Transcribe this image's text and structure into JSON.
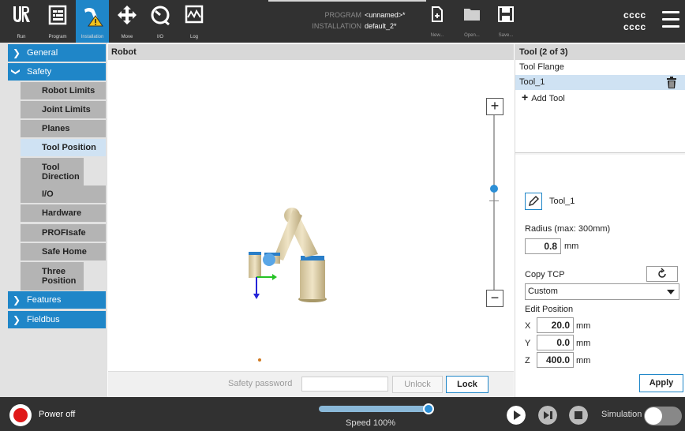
{
  "topbar": {
    "nav": [
      {
        "label": "Run",
        "icon": "ur-logo-icon"
      },
      {
        "label": "Program",
        "icon": "program-icon"
      },
      {
        "label": "Installation",
        "icon": "installation-warning-icon"
      },
      {
        "label": "Move",
        "icon": "move-arrows-icon"
      },
      {
        "label": "I/O",
        "icon": "io-gauge-icon"
      },
      {
        "label": "Log",
        "icon": "log-chart-icon"
      }
    ],
    "program_key": "PROGRAM",
    "program_value": "<unnamed>*",
    "installation_key": "INSTALLATION",
    "installation_value": "default_2*",
    "file_buttons": [
      {
        "label": "New...",
        "icon": "new-file-icon"
      },
      {
        "label": "Open...",
        "icon": "open-folder-icon"
      },
      {
        "label": "Save...",
        "icon": "save-disk-icon"
      }
    ],
    "user_line1": "cccc",
    "user_line2": "cccc"
  },
  "sidebar": {
    "sections": {
      "general": "General",
      "safety": "Safety",
      "features": "Features",
      "fieldbus": "Fieldbus"
    },
    "safety_items": [
      {
        "label": "Robot Limits"
      },
      {
        "label": "Joint Limits"
      },
      {
        "label": "Planes"
      },
      {
        "label": "Tool Position"
      },
      {
        "label": "Tool Direction"
      },
      {
        "label": "I/O"
      },
      {
        "label": "Hardware"
      },
      {
        "label": "PROFIsafe"
      },
      {
        "label": "Safe Home"
      },
      {
        "label": "Three Position"
      }
    ]
  },
  "view": {
    "title": "Robot",
    "zoom_in": "+",
    "zoom_out": "−",
    "password_label": "Safety password",
    "password_value": "",
    "unlock": "Unlock",
    "lock": "Lock"
  },
  "tool_panel": {
    "title": "Tool (2 of 3)",
    "tools": [
      {
        "label": "Tool Flange"
      },
      {
        "label": "Tool_1"
      }
    ],
    "add_tool": "Add Tool",
    "selected_name": "Tool_1",
    "radius_label": "Radius (max: 300mm)",
    "radius_value": "0.8",
    "radius_unit": "mm",
    "copy_tcp_label": "Copy TCP",
    "copy_tcp_option": "Custom",
    "edit_position_label": "Edit Position",
    "position": [
      {
        "axis": "X",
        "value": "20.0",
        "unit": "mm"
      },
      {
        "axis": "Y",
        "value": "0.0",
        "unit": "mm"
      },
      {
        "axis": "Z",
        "value": "400.0",
        "unit": "mm"
      }
    ],
    "apply": "Apply"
  },
  "footer": {
    "power_label": "Power off",
    "speed_label": "Speed 100%",
    "speed_percent": 100,
    "simulation_label": "Simulation",
    "simulation_on": false
  },
  "colors": {
    "accent": "#1f86c8",
    "topbar_bg": "#313131",
    "power_red": "#e01919"
  }
}
